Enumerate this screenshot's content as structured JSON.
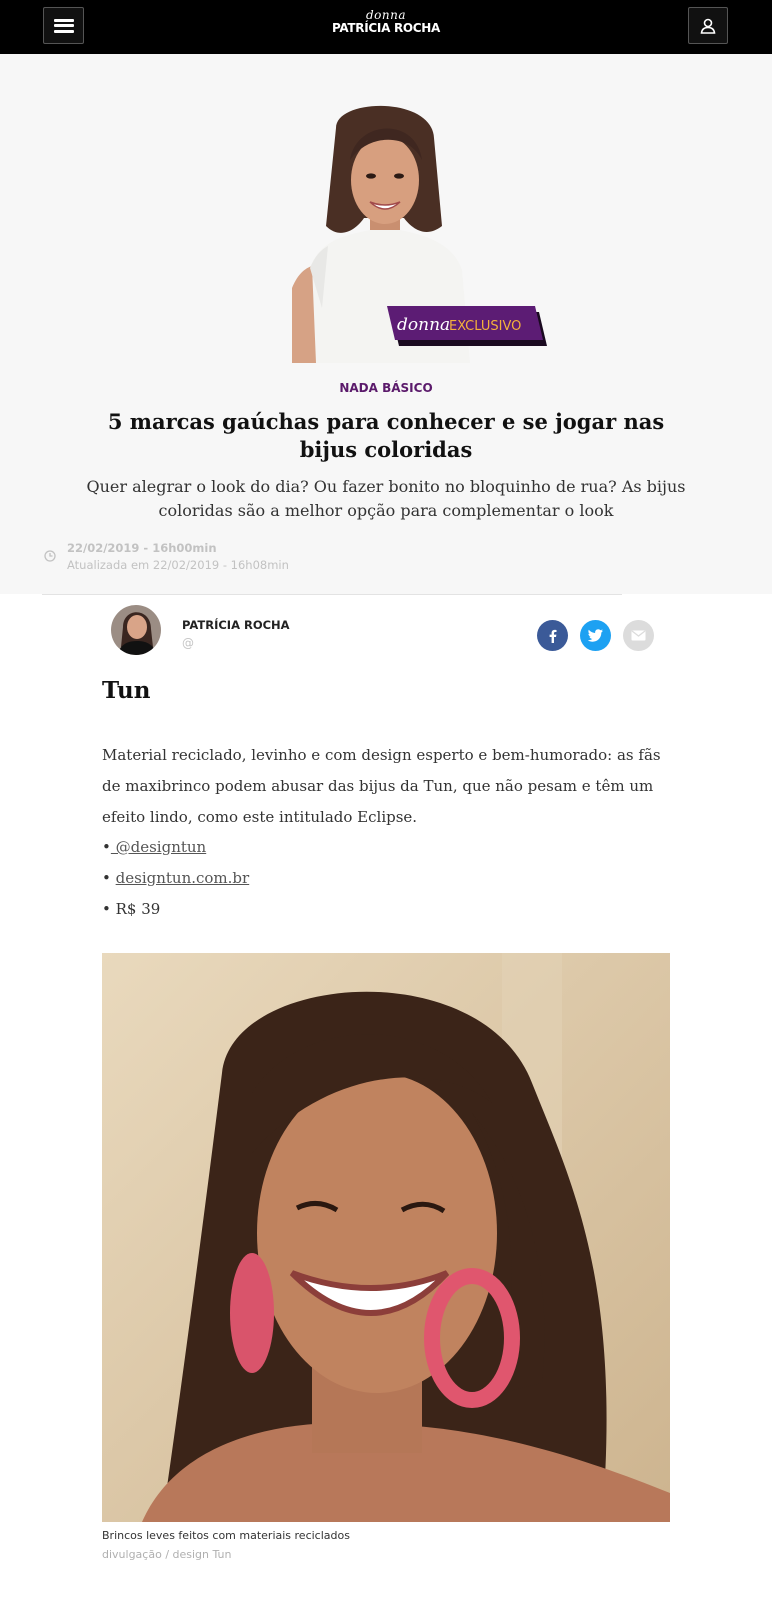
{
  "header": {
    "brand_top": "donna",
    "brand_bottom": "PATRÍCIA ROCHA",
    "menu_icon": "hamburger-icon",
    "user_icon": "user-icon"
  },
  "hero": {
    "badge_left": "donna",
    "badge_right": "EXCLUSIVO",
    "kicker": "NADA BÁSICO",
    "headline": "5 marcas gaúchas para conhecer e se jogar nas bijus coloridas",
    "subhead": "Quer alegrar o look do dia? Ou fazer bonito no bloquinho de rua? As bijus coloridas são a melhor opção para complementar o look",
    "published": "22/02/2019 - 16h00min",
    "updated": "Atualizada em 22/02/2019 - 16h08min"
  },
  "author": {
    "name": "PATRÍCIA ROCHA",
    "handle": "@"
  },
  "share": {
    "facebook_icon": "facebook-icon",
    "twitter_icon": "twitter-icon",
    "email_icon": "email-icon"
  },
  "article": {
    "section_title": "Tun",
    "paragraph": "Material reciclado, levinho e com design esperto e bem-humorado: as fãs de maxibrinco podem abusar das bijus da Tun, que não pesam e têm um efeito lindo, como este intitulado Eclipse.",
    "bullet_prefix": "•",
    "instagram": " @designtun",
    "website": "designtun.com.br",
    "price": "R$ 39",
    "caption": "Brincos leves feitos com materiais reciclados",
    "credit": "divulgação / design Tun"
  },
  "colors": {
    "accent": "#5b1a6b",
    "badge_bg": "#5c1c74",
    "badge_text": "#f3b13c",
    "earring": "#e0566e",
    "facebook": "#3b5a98",
    "twitter": "#1da1f2"
  }
}
